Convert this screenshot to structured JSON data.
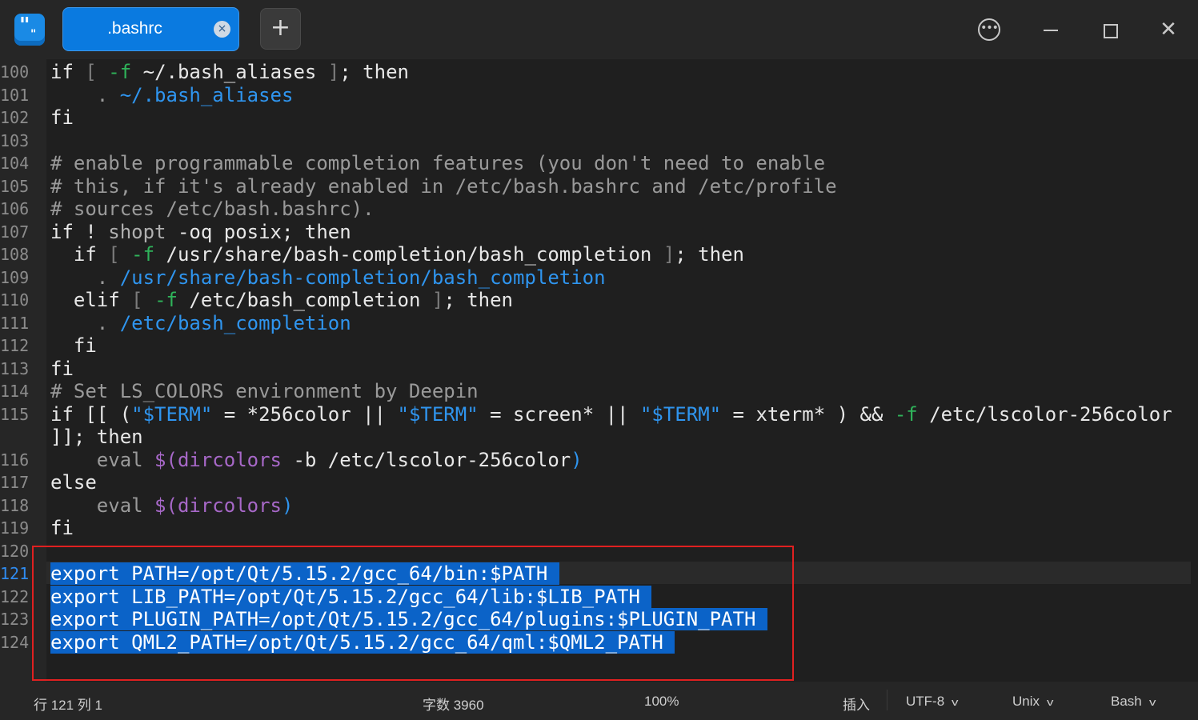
{
  "tab": {
    "title": ".bashrc"
  },
  "icons": {
    "logo": "text-editor-logo-icon",
    "close_tab": "close-icon",
    "new_tab": "plus-icon",
    "menu": "more-options-icon",
    "minimize": "minimize-icon",
    "maximize": "maximize-icon",
    "close_window": "close-icon",
    "chevron": "chevron-down-icon"
  },
  "glyphs": {
    "plus": "+",
    "close_tab": "×",
    "menu_dots": "•••",
    "close_window": "✕",
    "chevron": "v",
    "logo_q1": "\"",
    "logo_q2": "\""
  },
  "editor": {
    "lines": [
      {
        "n": "100"
      },
      {
        "n": "101"
      },
      {
        "n": "102"
      },
      {
        "n": "103"
      },
      {
        "n": "104"
      },
      {
        "n": "105"
      },
      {
        "n": "106"
      },
      {
        "n": "107"
      },
      {
        "n": "108"
      },
      {
        "n": "109"
      },
      {
        "n": "110"
      },
      {
        "n": "111"
      },
      {
        "n": "112"
      },
      {
        "n": "113"
      },
      {
        "n": "114"
      },
      {
        "n": "115"
      },
      {
        "n": "116"
      },
      {
        "n": "117"
      },
      {
        "n": "118"
      },
      {
        "n": "119"
      },
      {
        "n": "120"
      },
      {
        "n": "121"
      },
      {
        "n": "122"
      },
      {
        "n": "123"
      },
      {
        "n": "124"
      }
    ],
    "code": {
      "l100": [
        "if ",
        "[ ",
        "-f",
        " ~/.bash_aliases ",
        "]",
        "; then"
      ],
      "l101": [
        "    ",
        ". ",
        "~/.bash_aliases"
      ],
      "l102": "fi",
      "l104": "# enable programmable completion features (you don't need to enable",
      "l105": "# this, if it's already enabled in /etc/bash.bashrc and /etc/profile",
      "l106": "# sources /etc/bash.bashrc).",
      "l107": [
        "if ! ",
        "shopt",
        " -oq posix; then"
      ],
      "l108": [
        "  if ",
        "[ ",
        "-f",
        " /usr/share/bash-completion/bash_completion ",
        "]",
        "; then"
      ],
      "l109": [
        "    ",
        ". ",
        "/usr/share/bash-completion/bash_completion"
      ],
      "l110": [
        "  elif ",
        "[ ",
        "-f",
        " /etc/bash_completion ",
        "]",
        "; then"
      ],
      "l111": [
        "    ",
        ". ",
        "/etc/bash_completion"
      ],
      "l112": "  fi",
      "l113": "fi",
      "l114": "# Set LS_COLORS environment by Deepin",
      "l115": [
        "if [[ (",
        "\"$TERM\"",
        " = *256color || ",
        "\"$TERM\"",
        " = screen* || ",
        "\"$TERM\"",
        " = xterm* ) && ",
        "-f",
        " /etc/lscolor-256color"
      ],
      "l115b": "]]; then",
      "l116": [
        "    eval ",
        "$(",
        "dircolors",
        " -b /etc/lscolor-256color",
        ")"
      ],
      "l117": "else",
      "l118": [
        "    eval ",
        "$(",
        "dircolors",
        ")"
      ],
      "l119": "fi",
      "l121": "export PATH=/opt/Qt/5.15.2/gcc_64/bin:$PATH ",
      "l122": "export LIB_PATH=/opt/Qt/5.15.2/gcc_64/lib:$LIB_PATH ",
      "l123": "export PLUGIN_PATH=/opt/Qt/5.15.2/gcc_64/plugins:$PLUGIN_PATH ",
      "l124": "export QML2_PATH=/opt/Qt/5.15.2/gcc_64/qml:$QML2_PATH "
    }
  },
  "status": {
    "position": "行 121  列 1",
    "char_count": "字数 3960",
    "zoom": "100%",
    "mode": "插入",
    "encoding": "UTF-8",
    "line_ending": "Unix",
    "language": "Bash"
  },
  "colors": {
    "accent": "#0a7ae0",
    "selection": "#0b63c8",
    "highlight_box": "#e02020"
  }
}
